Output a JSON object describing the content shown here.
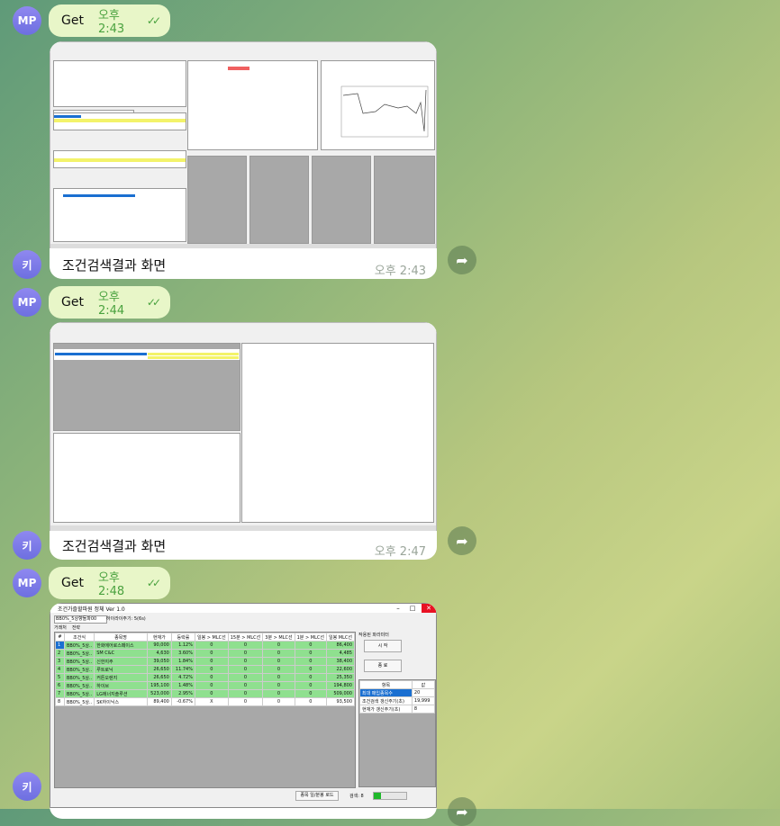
{
  "messages": [
    {
      "sender": "MP",
      "text": "Get",
      "time": "오후 2:43"
    },
    {
      "sender": "키",
      "caption": "조건검색결과 화면",
      "time": "오후 2:43"
    },
    {
      "sender": "MP",
      "text": "Get",
      "time": "오후 2:44"
    },
    {
      "sender": "키",
      "caption": "조건검색결과 화면",
      "time": "오후 2:47"
    },
    {
      "sender": "MP",
      "text": "Get",
      "time": "오후 2:48"
    },
    {
      "sender": "키"
    }
  ],
  "avatars": {
    "mp": "MP",
    "k": "키"
  },
  "icons": {
    "forward": "share-arrow-icon",
    "read": "double-check-icon"
  },
  "shot3": {
    "title": "조건가즐할파원 정체 Ver 1.0",
    "combo": "BB0%_5상향돌파00",
    "combo_label": "하이라이주기: 5(6s)",
    "tabs": [
      "거래처",
      "전략"
    ],
    "headers": [
      "#",
      "조건식",
      "종목명",
      "현재가",
      "등락률",
      "일봉 > MLC선",
      "15분 > MLC선",
      "3분 > MLC선",
      "1분 > MLC선",
      "일봉 MLC선"
    ],
    "rows": [
      [
        "1",
        "BB0%_5상..",
        "한화에어로스페이스",
        "90,000",
        "1.12%",
        "0",
        "0",
        "0",
        "0",
        "86,400"
      ],
      [
        "2",
        "BB0%_5상..",
        "SM C&C",
        "4,630",
        "3.60%",
        "0",
        "0",
        "0",
        "0",
        "4,485"
      ],
      [
        "3",
        "BB0%_5상..",
        "신한지주",
        "39,050",
        "1.84%",
        "0",
        "0",
        "0",
        "0",
        "38,400"
      ],
      [
        "4",
        "BB0%_5상..",
        "루트로닉",
        "26,650",
        "11.74%",
        "0",
        "0",
        "0",
        "0",
        "22,600"
      ],
      [
        "5",
        "BB0%_5상..",
        "커튼오렌지",
        "26,650",
        "4.72%",
        "0",
        "0",
        "0",
        "0",
        "25,350"
      ],
      [
        "6",
        "BB0%_5상..",
        "하이브",
        "195,100",
        "1.48%",
        "0",
        "0",
        "0",
        "0",
        "194,800"
      ],
      [
        "7",
        "BB0%_5상..",
        "LG에너지솔루션",
        "523,000",
        "2.95%",
        "0",
        "0",
        "0",
        "0",
        "509,000"
      ],
      [
        "8",
        "BB0%_5상..",
        "SK하이닉스",
        "89,400",
        "-0.67%",
        "X",
        "0",
        "0",
        "0",
        "93,500"
      ]
    ],
    "side_label": "작용된 파라미터",
    "start": "시 작",
    "stop": "종 료",
    "param_header": [
      "항목",
      "값"
    ],
    "params": [
      [
        "최대 매입종목수",
        "20"
      ],
      [
        "조건검색 갱신주기(초)",
        "19,999"
      ],
      [
        "현재가 갱신주기(초)",
        "8"
      ]
    ],
    "bottom_btn": "종목 일/분봉 로드",
    "bottom_label": "검색: 8"
  }
}
